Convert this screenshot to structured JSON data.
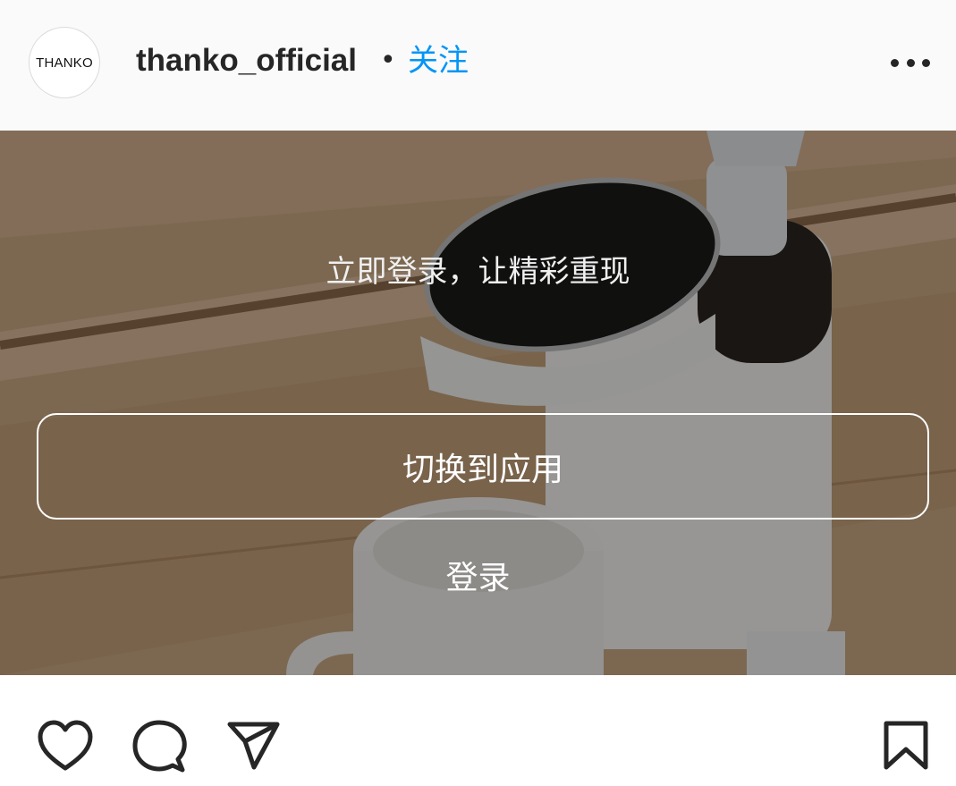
{
  "header": {
    "avatar_text": "THANKO",
    "username": "thanko_official",
    "separator": "•",
    "follow_label": "关注",
    "more_icon": "more-horizontal-icon"
  },
  "media": {
    "prompt": "立即登录，让精彩重现",
    "switch_app_label": "切换到应用",
    "login_label": "登录"
  },
  "actions": {
    "like_icon": "heart-icon",
    "comment_icon": "comment-icon",
    "share_icon": "share-icon",
    "save_icon": "bookmark-icon"
  },
  "colors": {
    "accent": "#0095f6",
    "text": "#262626",
    "header_bg": "#fafafa"
  }
}
